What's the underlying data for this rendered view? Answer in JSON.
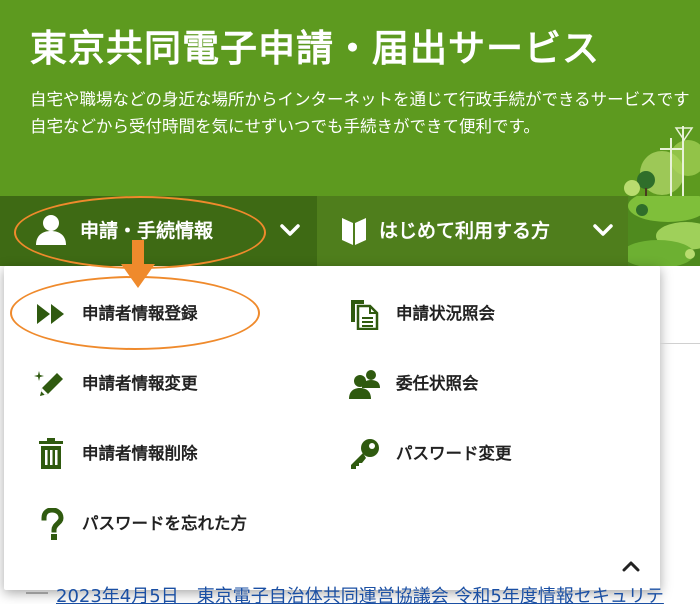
{
  "header": {
    "title": "東京共同電子申請・届出サービス",
    "description_line1": "自宅や職場などの身近な場所からインターネットを通じて行政手続ができるサービスです",
    "description_line2": "自宅などから受付時間を気にせずいつでも手続きができて便利です。"
  },
  "nav": {
    "tabs": [
      {
        "label": "申請・手続情報",
        "icon": "person-icon",
        "expanded": true
      },
      {
        "label": "はじめて利用する方",
        "icon": "beginner-mark-icon",
        "expanded": false
      }
    ]
  },
  "menu": {
    "items": [
      {
        "label": "申請者情報登録",
        "icon": "double-arrow-icon"
      },
      {
        "label": "申請状況照会",
        "icon": "documents-icon"
      },
      {
        "label": "申請者情報変更",
        "icon": "pencil-sparkle-icon"
      },
      {
        "label": "委任状照会",
        "icon": "people-icon"
      },
      {
        "label": "申請者情報削除",
        "icon": "trash-icon"
      },
      {
        "label": "パスワード変更",
        "icon": "key-icon"
      },
      {
        "label": "パスワードを忘れた方",
        "icon": "question-icon"
      }
    ],
    "collapse_icon": "chevron-up-icon"
  },
  "background": {
    "news_text": "2023年4月5日　東京電子自治体共同運営協議会 令和5年度情報セキュリテ"
  },
  "annotation": {
    "color": "#ef8a2c"
  },
  "colors": {
    "hero_green": "#5d9a1f",
    "nav_dark_green": "#3e6a14",
    "icon_green": "#2f5a0f"
  }
}
